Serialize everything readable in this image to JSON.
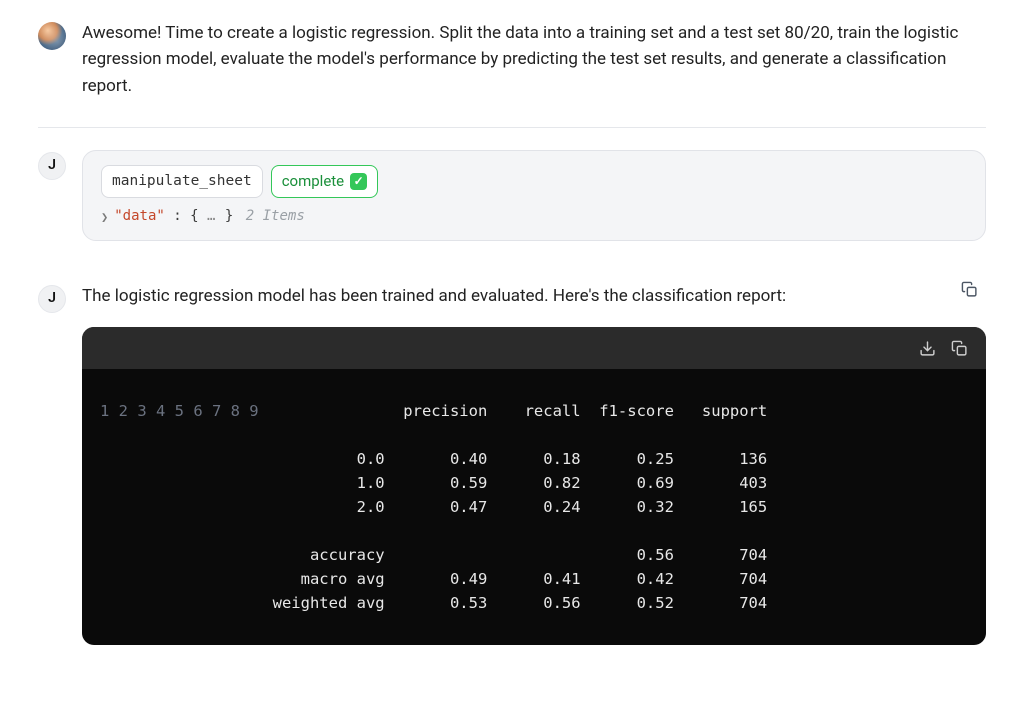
{
  "user_message": {
    "text": "Awesome! Time to create a logistic regression. Split the data into a training set and a test set 80/20, train the logistic regression model, evaluate the model's performance by predicting the test set results, and generate a classification report."
  },
  "assistant_letter": "J",
  "tool_call": {
    "name": "manipulate_sheet",
    "status_label": "complete",
    "expand": {
      "key": "\"data\"",
      "colon": ":",
      "brace_open": "{",
      "ellipsis": "…",
      "brace_close": "}",
      "meta": "2 Items"
    }
  },
  "response": {
    "intro": "The logistic regression model has been trained and evaluated. Here's the classification report:"
  },
  "chart_data": {
    "type": "table",
    "title": "classification report",
    "columns": [
      "",
      "precision",
      "recall",
      "f1-score",
      "support"
    ],
    "rows": [
      {
        "label": "0.0",
        "precision": 0.4,
        "recall": 0.18,
        "f1": 0.25,
        "support": 136
      },
      {
        "label": "1.0",
        "precision": 0.59,
        "recall": 0.82,
        "f1": 0.69,
        "support": 403
      },
      {
        "label": "2.0",
        "precision": 0.47,
        "recall": 0.24,
        "f1": 0.32,
        "support": 165
      },
      {
        "label": "accuracy",
        "precision": null,
        "recall": null,
        "f1": 0.56,
        "support": 704
      },
      {
        "label": "macro avg",
        "precision": 0.49,
        "recall": 0.41,
        "f1": 0.42,
        "support": 704
      },
      {
        "label": "weighted avg",
        "precision": 0.53,
        "recall": 0.56,
        "f1": 0.52,
        "support": 704
      }
    ],
    "raw_lines": [
      "              precision    recall  f1-score   support",
      "",
      "         0.0       0.40      0.18      0.25       136",
      "         1.0       0.59      0.82      0.69       403",
      "         2.0       0.47      0.24      0.32       165",
      "",
      "    accuracy                           0.56       704",
      "   macro avg       0.49      0.41      0.42       704",
      "weighted avg       0.53      0.56      0.52       704"
    ]
  }
}
